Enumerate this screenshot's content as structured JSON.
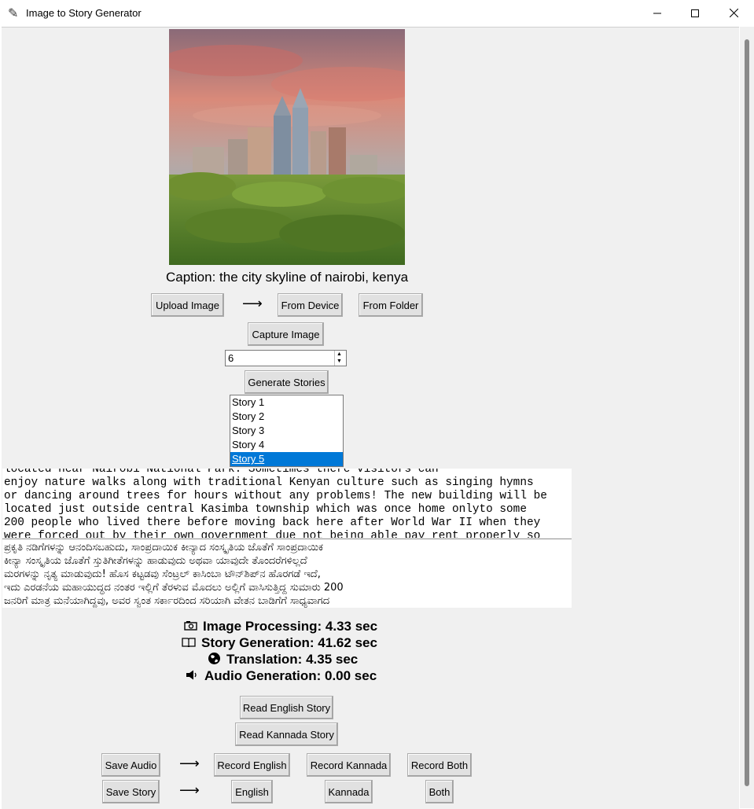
{
  "window": {
    "title": "Image to Story Generator",
    "minimize": "—",
    "maximize": "☐",
    "close": "✕"
  },
  "caption": "Caption: the city skyline of nairobi, kenya",
  "buttons": {
    "upload_image": "Upload Image",
    "from_device": "From Device",
    "from_folder": "From Folder",
    "capture_image": "Capture Image",
    "generate_stories": "Generate Stories",
    "read_english": "Read English Story",
    "read_kannada": "Read Kannada Story",
    "save_audio": "Save Audio",
    "record_english": "Record English",
    "record_kannada": "Record Kannada",
    "record_both": "Record Both",
    "save_story": "Save Story",
    "english": "English",
    "kannada": "Kannada",
    "both": "Both"
  },
  "arrow": "⟶",
  "story_count": "6",
  "stories": [
    "Story 1",
    "Story 2",
    "Story 3",
    "Story 4",
    "Story 5"
  ],
  "selected_story": "Story 5",
  "english_story": "located near Nairobi National Park. Sometimes there visitors can\nenjoy nature walks along with traditional Kenyan culture such as singing hymns\nor dancing around trees for hours without any problems! The new building will be\nlocated just outside central Kasimba township which was once home onlyto some\n200 people who lived there before moving back here after World War II when they\nwere forced out by their own government due not being able pay rent properly so",
  "kannada_story": "ಪ್ರಕೃತಿ ನಡಿಗೆಗಳನ್ನು ಆನಂದಿಸಬಹುದು, ಸಾಂಪ್ರದಾಯಿಕ ಕೀನ್ಯಾದ ಸಂಸ್ಕೃತಿಯ ಜೊತೆಗೆ ಸಾಂಪ್ರದಾಯಿಕ\nಕೀನ್ಯಾ ಸಂಸ್ಕೃತಿಯ ಜೊತೆಗೆ ಸ್ತುತಿಗೀತೆಗಳನ್ನು ಹಾಡುವುದು ಅಥವಾ ಯಾವುದೇ ತೊಂದರೆಗಳಿಲ್ಲದೆ\nಮರಗಳನ್ನು ನೃತ್ಯ ಮಾಡುವುದು! ಹೊಸ ಕಟ್ಟಡವು ಸೆಂಟ್ರಲ್ ಕಾಸಿಂಬಾ ಟೌನ್‌ಶಿಪ್‌ನ ಹೊರಗಡೆ ಇದೆ,\nಇದು ಎರಡನೆಯ ಮಹಾಯುದ್ಧದ ನಂತರ ಇಲ್ಲಿಗೆ ತೆರಳುವ ಮೊದಲು ಅಲ್ಲಿಗೆ ವಾಸಿಸುತ್ತಿದ್ದ ಸುಮಾರು 200\nಜನರಿಗೆ ಮಾತ್ರ ಮನೆಯಾಗಿದ್ದವು, ಅವರ ಸ್ವಂತ ಸರ್ಕಾರದಿಂದ ಸರಿಯಾಗಿ ವೇತನ ಬಾಡಿಗೆಗೆ ಸಾಧ್ಯವಾಗದ",
  "stats": {
    "image_processing": "Image Processing: 4.33 sec",
    "story_generation": "Story Generation: 41.62 sec",
    "translation": "Translation: 4.35 sec",
    "audio_generation": "Audio Generation: 0.00 sec"
  },
  "icons": {
    "app": "feather-icon",
    "image_processing": "camera-icon",
    "story_generation": "book-icon",
    "translation": "globe-icon",
    "audio_generation": "speaker-icon"
  },
  "colors": {
    "selection": "#0078d7",
    "button_bg": "#e1e1e1"
  }
}
